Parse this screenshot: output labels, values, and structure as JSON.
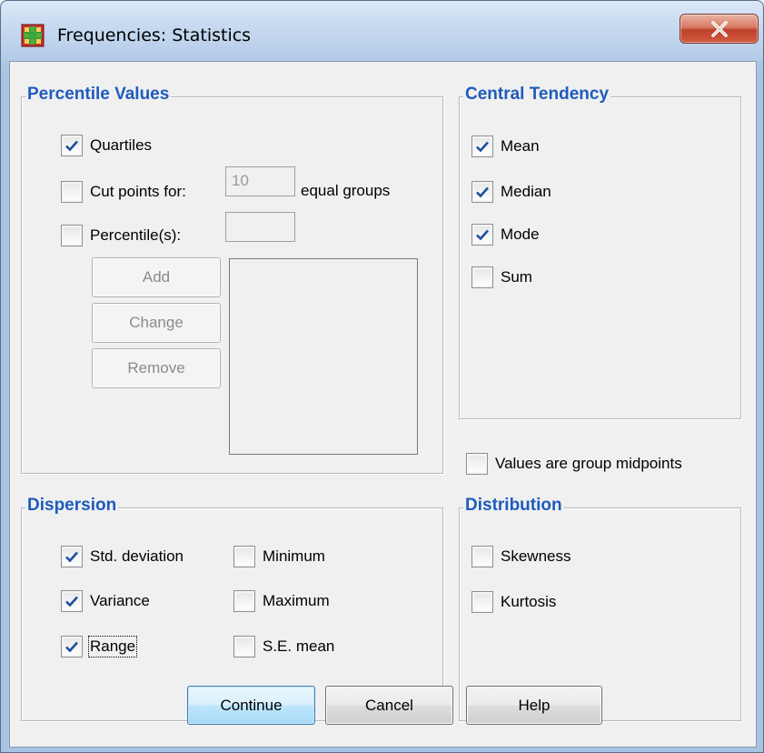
{
  "window": {
    "title": "Frequencies: Statistics",
    "close_label": "X"
  },
  "percentile_values": {
    "title": "Percentile Values",
    "quartiles": {
      "label": "Quartiles",
      "checked": true
    },
    "cut_points": {
      "label": "Cut points for:",
      "value": "10",
      "suffix": "equal groups",
      "checked": false
    },
    "percentiles": {
      "label": "Percentile(s):",
      "value": "",
      "checked": false
    },
    "add_label": "Add",
    "change_label": "Change",
    "remove_label": "Remove"
  },
  "central_tendency": {
    "title": "Central Tendency",
    "mean": {
      "label": "Mean",
      "checked": true
    },
    "median": {
      "label": "Median",
      "checked": true
    },
    "mode": {
      "label": "Mode",
      "checked": true
    },
    "sum": {
      "label": "Sum",
      "checked": false
    }
  },
  "group_midpoints": {
    "label": "Values are group midpoints",
    "checked": false
  },
  "dispersion": {
    "title": "Dispersion",
    "std_deviation": {
      "label": "Std. deviation",
      "checked": true
    },
    "variance": {
      "label": "Variance",
      "checked": true
    },
    "range": {
      "label": "Range",
      "checked": true
    },
    "minimum": {
      "label": "Minimum",
      "checked": false
    },
    "maximum": {
      "label": "Maximum",
      "checked": false
    },
    "se_mean": {
      "label": "S.E. mean",
      "checked": false
    }
  },
  "distribution": {
    "title": "Distribution",
    "skewness": {
      "label": "Skewness",
      "checked": false
    },
    "kurtosis": {
      "label": "Kurtosis",
      "checked": false
    }
  },
  "footer": {
    "continue_label": "Continue",
    "cancel_label": "Cancel",
    "help_label": "Help"
  },
  "colors": {
    "group_title": "#1f5bbd",
    "check_mark": "#1c4fa0",
    "close_button": "#c8452c"
  },
  "icons": {
    "app": "spss-table-icon",
    "close": "close-icon",
    "check": "checkmark-icon"
  }
}
